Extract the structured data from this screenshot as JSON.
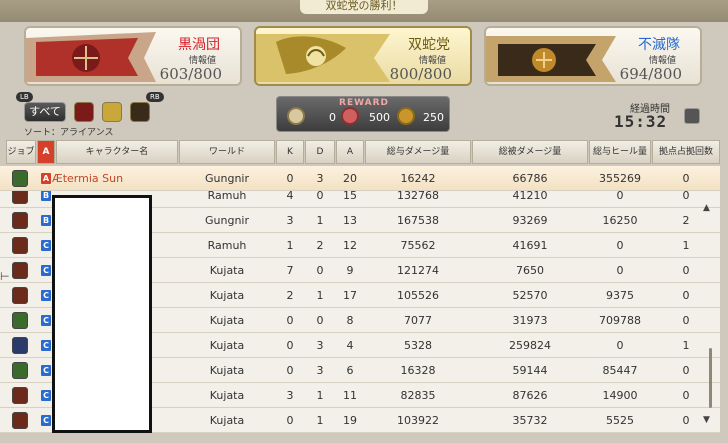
{
  "header": {
    "victory_text": "双蛇党の勝利！"
  },
  "teams": [
    {
      "name": "黒渦団",
      "info_label": "情報値",
      "score": "603/800",
      "color": "#d4202a"
    },
    {
      "name": "双蛇党",
      "info_label": "情報値",
      "score": "800/800",
      "color": "#6b5a10"
    },
    {
      "name": "不滅隊",
      "info_label": "情報値",
      "score": "694/800",
      "color": "#2a6bd0"
    }
  ],
  "controls": {
    "lb": "LB",
    "rb": "RB",
    "all_label": "すべて",
    "sort_label": "ソート：アライアンス"
  },
  "reward": {
    "title": "REWARD",
    "values": [
      "0",
      "500",
      "250"
    ]
  },
  "elapsed": {
    "label": "経過時間",
    "time": "15:32"
  },
  "table": {
    "headers": [
      "ジョブ",
      "A",
      "キャラクター名",
      "ワールド",
      "K",
      "D",
      "A",
      "総与ダメージ量",
      "総被ダメージ量",
      "総与ヒール量",
      "拠点占拠回数"
    ],
    "rows": [
      {
        "alliance": "A",
        "name": "Ætermia Sun",
        "world": "Gungnir",
        "k": "0",
        "d": "3",
        "a": "20",
        "dmg": "16242",
        "taken": "66786",
        "heal": "355269",
        "cap": "0",
        "job_color": "#3a6b2a"
      },
      {
        "alliance": "B",
        "name": "",
        "world": "Ramuh",
        "k": "4",
        "d": "0",
        "a": "15",
        "dmg": "132768",
        "taken": "41210",
        "heal": "0",
        "cap": "0",
        "job_color": "#6b2a1a"
      },
      {
        "alliance": "B",
        "name": "",
        "world": "Gungnir",
        "k": "3",
        "d": "1",
        "a": "13",
        "dmg": "167538",
        "taken": "93269",
        "heal": "16250",
        "cap": "2",
        "job_color": "#6b2a1a"
      },
      {
        "alliance": "C",
        "name": "",
        "world": "Ramuh",
        "k": "1",
        "d": "2",
        "a": "12",
        "dmg": "75562",
        "taken": "41691",
        "heal": "0",
        "cap": "1",
        "job_color": "#6b2a1a"
      },
      {
        "alliance": "C",
        "name": "",
        "world": "Kujata",
        "k": "7",
        "d": "0",
        "a": "9",
        "dmg": "121274",
        "taken": "7650",
        "heal": "0",
        "cap": "0",
        "job_color": "#6b2a1a"
      },
      {
        "alliance": "C",
        "name": "",
        "world": "Kujata",
        "k": "2",
        "d": "1",
        "a": "17",
        "dmg": "105526",
        "taken": "52570",
        "heal": "9375",
        "cap": "0",
        "job_color": "#6b2a1a"
      },
      {
        "alliance": "C",
        "name": "",
        "world": "Kujata",
        "k": "0",
        "d": "0",
        "a": "8",
        "dmg": "7077",
        "taken": "31973",
        "heal": "709788",
        "cap": "0",
        "job_color": "#3a6b2a"
      },
      {
        "alliance": "C",
        "name": "",
        "world": "Kujata",
        "k": "0",
        "d": "3",
        "a": "4",
        "dmg": "5328",
        "taken": "259824",
        "heal": "0",
        "cap": "1",
        "job_color": "#2a3a6b"
      },
      {
        "alliance": "C",
        "name": "",
        "world": "Kujata",
        "k": "0",
        "d": "3",
        "a": "6",
        "dmg": "16328",
        "taken": "59144",
        "heal": "85447",
        "cap": "0",
        "job_color": "#3a6b2a"
      },
      {
        "alliance": "C",
        "name": "",
        "world": "Kujata",
        "k": "3",
        "d": "1",
        "a": "11",
        "dmg": "82835",
        "taken": "87626",
        "heal": "14900",
        "cap": "0",
        "job_color": "#6b2a1a"
      },
      {
        "alliance": "C",
        "name": "",
        "world": "Kujata",
        "k": "0",
        "d": "1",
        "a": "19",
        "dmg": "103922",
        "taken": "35732",
        "heal": "5525",
        "cap": "0",
        "job_color": "#6b2a1a"
      }
    ]
  },
  "colors": {
    "alliance_a": "#d4402a",
    "alliance_b": "#2a6bd0",
    "alliance_c": "#2a6bd0"
  }
}
